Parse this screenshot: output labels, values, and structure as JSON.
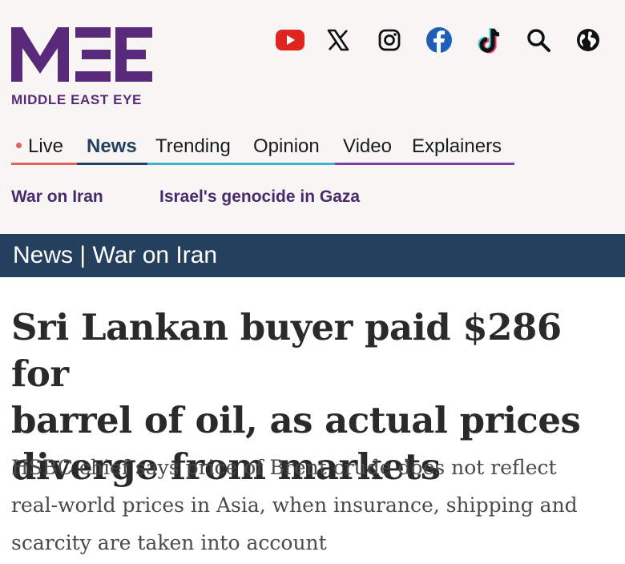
{
  "brand": {
    "name": "MIDDLE EAST EYE",
    "primary_color": "#5a2a7a"
  },
  "social_icons": [
    {
      "name": "youtube-icon",
      "color": "#e0251f"
    },
    {
      "name": "x-icon",
      "color": "#111111"
    },
    {
      "name": "instagram-icon",
      "color": "#111111"
    },
    {
      "name": "facebook-icon",
      "color": "#1f5fb8"
    },
    {
      "name": "tiktok-icon",
      "color": "#111111"
    },
    {
      "name": "search-icon",
      "color": "#111111"
    },
    {
      "name": "globe-icon",
      "color": "#111111"
    }
  ],
  "nav": {
    "items": [
      {
        "label": "Live",
        "underline": "#e0625a"
      },
      {
        "label": "News",
        "underline": "#24405c",
        "active": true,
        "text_color": "#24405c"
      },
      {
        "label": "Trending",
        "underline": "#3cb6c9"
      },
      {
        "label": "Opinion",
        "underline": "#3cb6c9"
      },
      {
        "label": "Video",
        "underline": "#7a3fa0"
      },
      {
        "label": "Explainers",
        "underline": "#7a3fa0"
      }
    ]
  },
  "topics": [
    "War on Iran",
    "Israel's genocide in Gaza"
  ],
  "section": {
    "category": "News",
    "separator": "|",
    "topic": "War on Iran",
    "background": "#24405c"
  },
  "article": {
    "headline_lines": [
      "Sri Lankan buyer paid $286 for",
      "barrel of oil, as actual prices",
      "diverge from markets"
    ],
    "standfirst_lines": [
      "HSBC chief says price of Brent crude does not reflect",
      "real-world prices in Asia, when insurance, shipping and",
      "scarcity are taken into account"
    ]
  }
}
